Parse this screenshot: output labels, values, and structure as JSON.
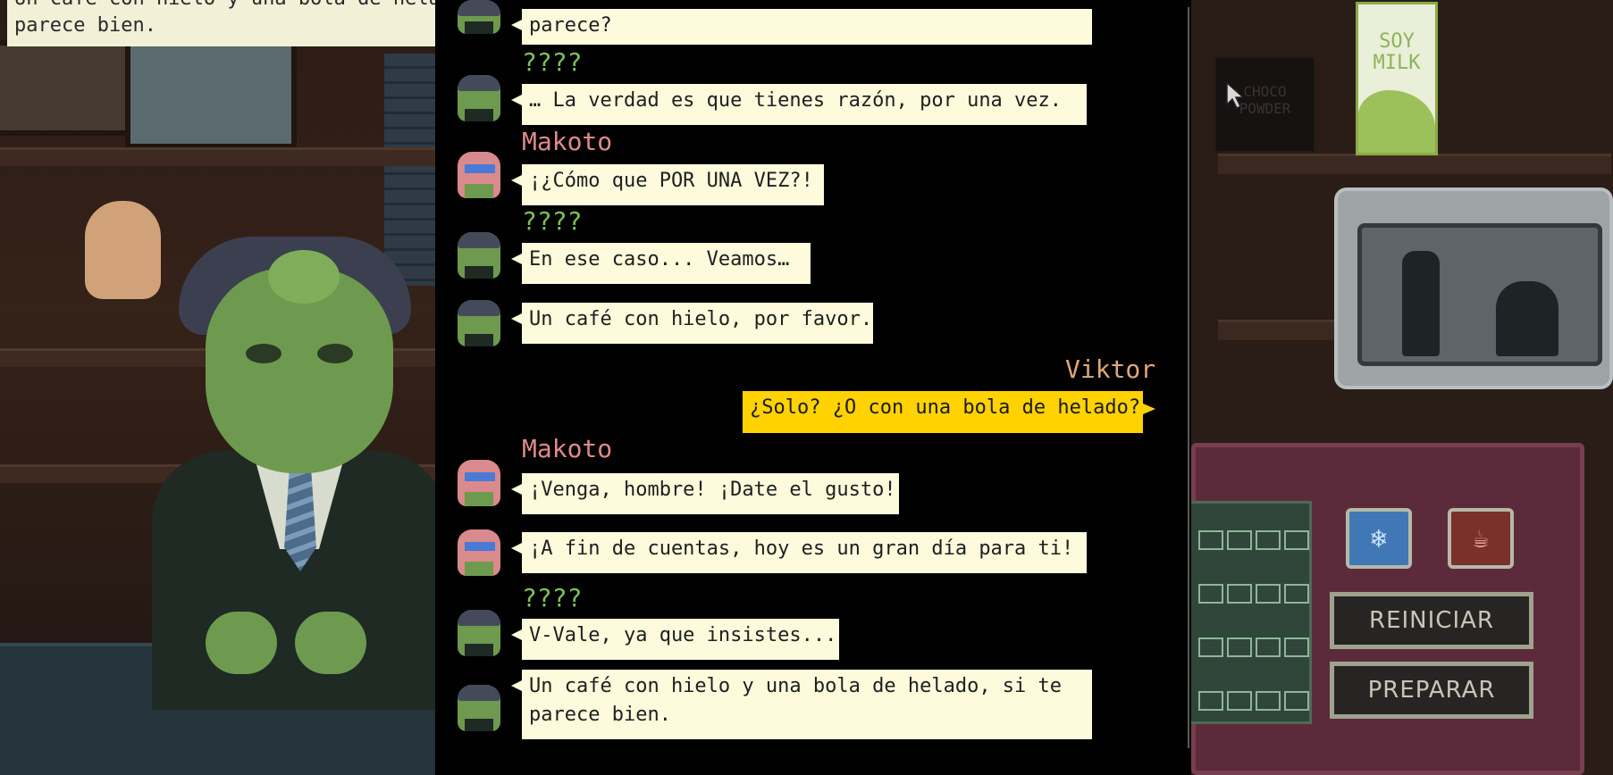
{
  "top_speech": {
    "line1": "Un café con hielo y una bola de helado, si te",
    "line2": "parece bien."
  },
  "log": {
    "messages": [
      {
        "speaker": "",
        "text": "parece?"
      },
      {
        "speaker": "????",
        "text": "… La verdad es que tienes razón, por una vez."
      },
      {
        "speaker": "Makoto",
        "text": "¡¿Cómo que POR UNA VEZ?!"
      },
      {
        "speaker": "????",
        "text": "En ese caso... Veamos…"
      },
      {
        "speaker": "",
        "text": "Un café con hielo, por favor."
      },
      {
        "speaker": "Viktor",
        "text": "¿Solo? ¿O con una bola de helado?"
      },
      {
        "speaker": "Makoto",
        "text": "¡Venga, hombre! ¡Date el gusto!"
      },
      {
        "speaker": "",
        "text": "¡A fin de cuentas, hoy es un gran día para ti!"
      },
      {
        "speaker": "????",
        "text": "V-Vale, ya que insistes..."
      },
      {
        "speaker": "",
        "text": "Un café con hielo y una bola de helado, si te",
        "text2": "parece bien."
      }
    ]
  },
  "colors": {
    "unknown_name": "#7fbf5a",
    "makoto_name": "#e08a8a",
    "viktor_name": "#e0a878",
    "npc_bubble": "#fdfbdc",
    "player_bubble": "#ffd200",
    "panel": "#5c2b3b"
  },
  "scene": {
    "soy_milk_label_1": "SOY",
    "soy_milk_label_2": "MILK",
    "choco_label": "CHOCO POWDER"
  },
  "panel": {
    "reset_label": "REINICIAR",
    "prepare_label": "PREPARAR",
    "ingredient_icons": [
      "ice-icon",
      "hot-coffee-icon"
    ]
  }
}
